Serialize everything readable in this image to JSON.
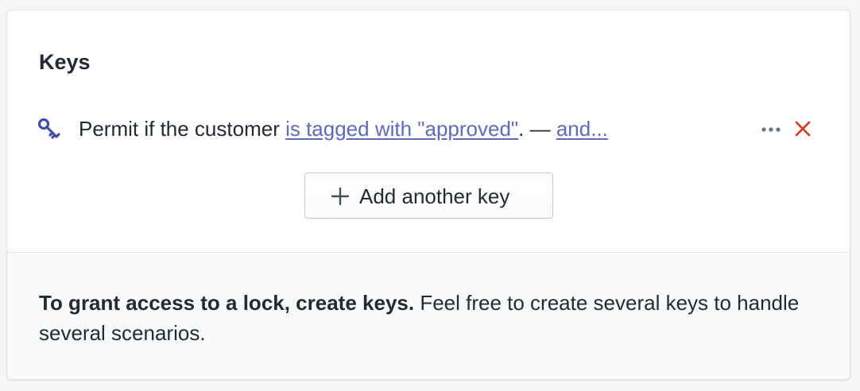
{
  "card": {
    "title": "Keys"
  },
  "key_row": {
    "icon": "key-icon",
    "prefix": "Permit if the customer ",
    "condition_link": "is tagged with \"approved\"",
    "separator": ".  — ",
    "and_link": "and...",
    "more_icon": "ellipsis-icon",
    "remove_icon": "close-icon"
  },
  "add_button": {
    "icon": "plus-icon",
    "label": "Add another key"
  },
  "footer": {
    "bold_text": "To grant access to a lock, create keys.",
    "text": " Feel free to create several keys to handle several scenarios."
  },
  "colors": {
    "link": "#5c6ac4",
    "text": "#212b36",
    "remove": "#de3618",
    "icon": "#3f4eae"
  }
}
